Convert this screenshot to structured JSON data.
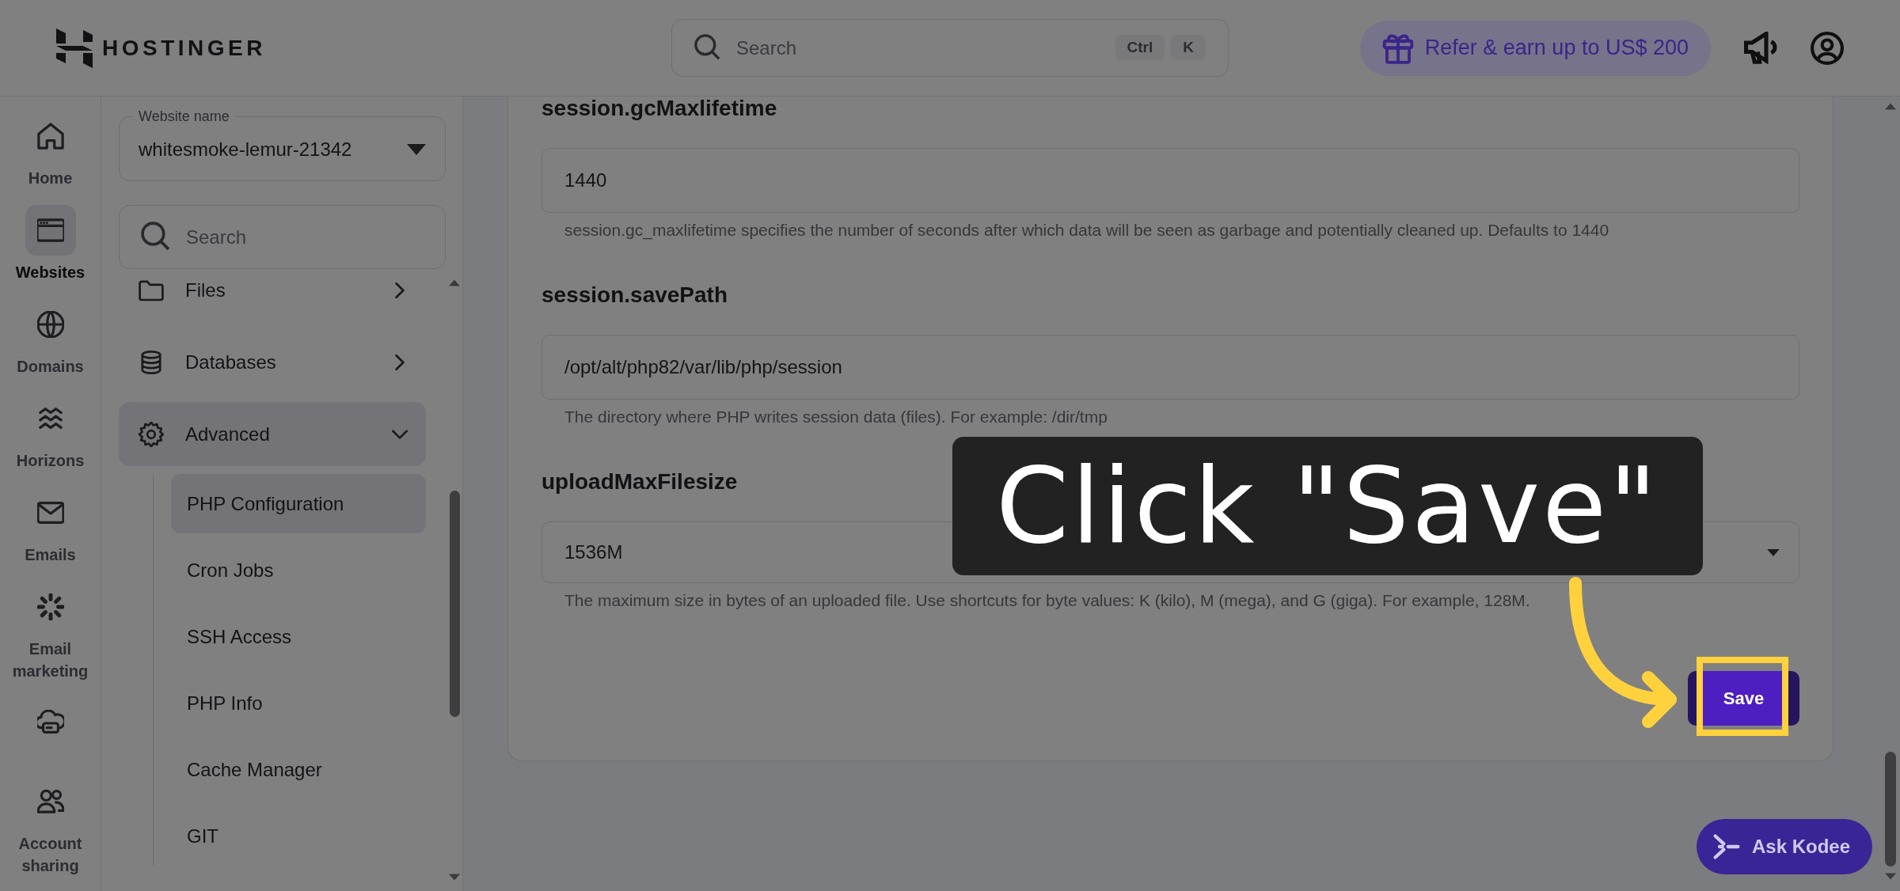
{
  "topbar": {
    "logo": "HOSTINGER",
    "search": {
      "placeholder": "Search",
      "shortcut_keys": [
        "Ctrl",
        "K"
      ]
    },
    "promo": "Refer & earn up to US$ 200"
  },
  "nav_rail": [
    {
      "label": "Home",
      "selected": false
    },
    {
      "label": "Websites",
      "selected": true
    },
    {
      "label": "Domains",
      "selected": false
    },
    {
      "label": "Horizons",
      "selected": false
    },
    {
      "label": "Emails",
      "selected": false
    },
    {
      "label": "Email marketing",
      "selected": false
    },
    {
      "selected": false
    }
  ],
  "nav_rail_bottom": {
    "label": "Account sharing",
    "selected": false
  },
  "site_menu": {
    "website_select": {
      "label": "Website name",
      "value": "whitesmoke-lemur-21342"
    },
    "search": {
      "placeholder": "Search"
    },
    "items": [
      {
        "label": "Files",
        "expanded": false
      },
      {
        "label": "Databases",
        "expanded": false
      },
      {
        "label": "Advanced",
        "expanded": true,
        "children": [
          {
            "label": "PHP Configuration",
            "selected": true
          },
          {
            "label": "Cron Jobs",
            "selected": false
          },
          {
            "label": "SSH Access",
            "selected": false
          },
          {
            "label": "PHP Info",
            "selected": false
          },
          {
            "label": "Cache Manager",
            "selected": false
          },
          {
            "label": "GIT",
            "selected": false
          }
        ]
      }
    ]
  },
  "php_settings": [
    {
      "name": "session.gcMaxlifetime",
      "kind": "text",
      "value": "1440",
      "help": "session.gc_maxlifetime specifies the number of seconds after which data will be seen as garbage and potentially cleaned up. Defaults to 1440"
    },
    {
      "name": "session.savePath",
      "kind": "text",
      "value": "/opt/alt/php82/var/lib/php/session",
      "help": "The directory where PHP writes session data (files). For example: /dir/tmp"
    },
    {
      "name": "uploadMaxFilesize",
      "kind": "select",
      "value": "1536M",
      "help": "The maximum size in bytes of an uploaded file. Use shortcuts for byte values: K (kilo), M (mega), and G (giga). For example, 128M."
    }
  ],
  "save_button": "Save",
  "tutorial": {
    "callout": "Click \"Save\""
  },
  "assistant_button": "Ask Kodee"
}
